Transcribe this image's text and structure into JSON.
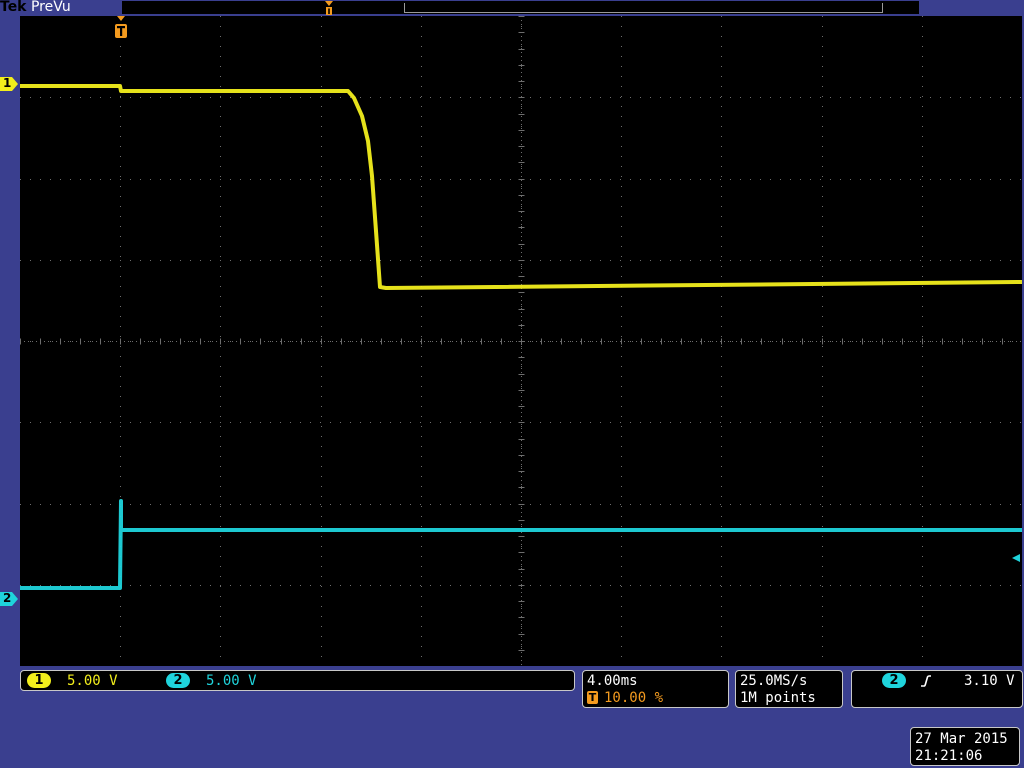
{
  "header": {
    "brand": "Tek",
    "mode": "PreVu"
  },
  "colors": {
    "ch1": "#f2ee1c",
    "ch2": "#1fd4dc",
    "trigger": "#f49b1f",
    "frame": "#3a3f8f",
    "grid": "#6e6e6e"
  },
  "markers": {
    "ch1_label": "1",
    "ch2_label": "2",
    "trigger_label": "T"
  },
  "channels": [
    {
      "label": "1",
      "scale": "5.00 V"
    },
    {
      "label": "2",
      "scale": "5.00 V"
    }
  ],
  "timebase": {
    "scale": "4.00ms",
    "trigger_icon": "T",
    "position": "10.00 %"
  },
  "acquisition": {
    "sample_rate": "25.0MS/s",
    "record_length": "1M points"
  },
  "trigger": {
    "source": "2",
    "slope_icon": "rising-edge-icon",
    "slope_symbol": "ʃ",
    "level": "3.10 V"
  },
  "datetime": {
    "date": "27 Mar 2015",
    "time": "21:21:06"
  }
}
